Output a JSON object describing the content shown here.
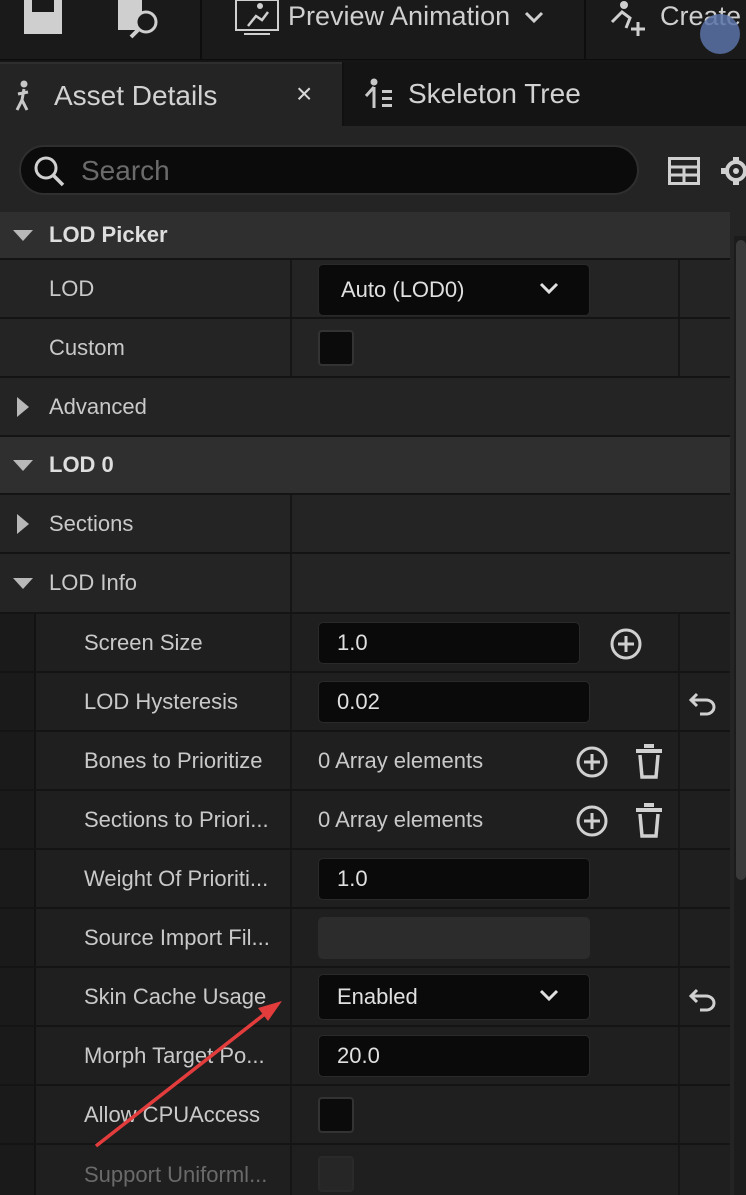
{
  "toolbar": {
    "preview_animation_label": "Preview Animation",
    "create_label": "Create"
  },
  "tabs": [
    {
      "label": "Asset Details",
      "close": "×"
    },
    {
      "label": "Skeleton Tree"
    }
  ],
  "search": {
    "placeholder": "Search"
  },
  "rows": {
    "lod_picker": "LOD Picker",
    "lod": {
      "label": "LOD",
      "value": "Auto (LOD0)"
    },
    "custom": {
      "label": "Custom"
    },
    "advanced": "Advanced",
    "lod0": "LOD 0",
    "sections": "Sections",
    "lod_info": "LOD Info",
    "screen_size": {
      "label": "Screen Size",
      "value": "1.0"
    },
    "lod_hysteresis": {
      "label": "LOD Hysteresis",
      "value": "0.02"
    },
    "bones_to_prioritize": {
      "label": "Bones to Prioritize",
      "value": "0 Array elements"
    },
    "sections_to_prioritize": {
      "label": "Sections to Priori...",
      "value": "0 Array elements"
    },
    "weight_of_prioritization": {
      "label": "Weight Of Prioriti...",
      "value": "1.0"
    },
    "source_import_file": {
      "label": "Source Import Fil..."
    },
    "skin_cache_usage": {
      "label": "Skin Cache Usage",
      "value": "Enabled"
    },
    "morph_target_pos": {
      "label": "Morph Target Po...",
      "value": "20.0"
    },
    "allow_cpu_access": {
      "label": "Allow CPUAccess"
    },
    "support_uniformly": {
      "label": "Support Uniforml..."
    }
  },
  "colors": {
    "annotation_arrow": "#e23c3c",
    "panel_bg": "#242424",
    "field_bg": "#0a0a0a"
  }
}
